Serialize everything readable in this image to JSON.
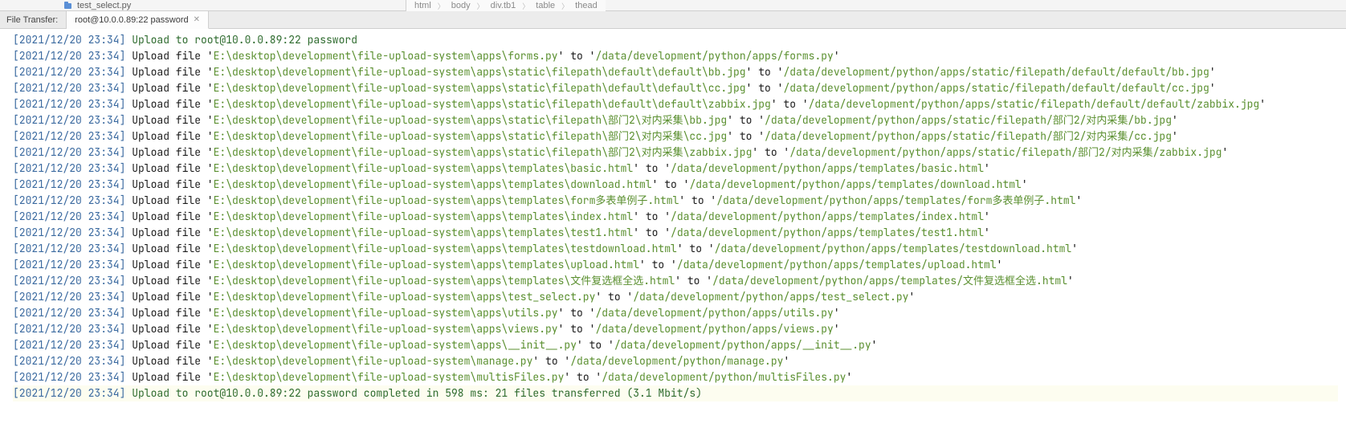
{
  "top_strip": {
    "filename": "test_select.py"
  },
  "breadcrumbs": {
    "items": [
      "html",
      "body",
      "div.tb1",
      "table",
      "thead"
    ]
  },
  "tab_bar": {
    "label": "File Transfer:",
    "active_tab": "root@10.0.0.89:22 password"
  },
  "log": {
    "timestamp": "[2021/12/20 23:34]",
    "header": "Upload to root@10.0.0.89:22 password",
    "lines": [
      {
        "src": "E:\\desktop\\development\\file-upload-system\\apps\\forms.py",
        "dst": "/data/development/python/apps/forms.py"
      },
      {
        "src": "E:\\desktop\\development\\file-upload-system\\apps\\static\\filepath\\default\\default\\bb.jpg",
        "dst": "/data/development/python/apps/static/filepath/default/default/bb.jpg"
      },
      {
        "src": "E:\\desktop\\development\\file-upload-system\\apps\\static\\filepath\\default\\default\\cc.jpg",
        "dst": "/data/development/python/apps/static/filepath/default/default/cc.jpg"
      },
      {
        "src": "E:\\desktop\\development\\file-upload-system\\apps\\static\\filepath\\default\\default\\zabbix.jpg",
        "dst": "/data/development/python/apps/static/filepath/default/default/zabbix.jpg"
      },
      {
        "src": "E:\\desktop\\development\\file-upload-system\\apps\\static\\filepath\\部门2\\对内采集\\bb.jpg",
        "dst": "/data/development/python/apps/static/filepath/部门2/对内采集/bb.jpg"
      },
      {
        "src": "E:\\desktop\\development\\file-upload-system\\apps\\static\\filepath\\部门2\\对内采集\\cc.jpg",
        "dst": "/data/development/python/apps/static/filepath/部门2/对内采集/cc.jpg"
      },
      {
        "src": "E:\\desktop\\development\\file-upload-system\\apps\\static\\filepath\\部门2\\对内采集\\zabbix.jpg",
        "dst": "/data/development/python/apps/static/filepath/部门2/对内采集/zabbix.jpg"
      },
      {
        "src": "E:\\desktop\\development\\file-upload-system\\apps\\templates\\basic.html",
        "dst": "/data/development/python/apps/templates/basic.html"
      },
      {
        "src": "E:\\desktop\\development\\file-upload-system\\apps\\templates\\download.html",
        "dst": "/data/development/python/apps/templates/download.html"
      },
      {
        "src": "E:\\desktop\\development\\file-upload-system\\apps\\templates\\form多表单例子.html",
        "dst": "/data/development/python/apps/templates/form多表单例子.html"
      },
      {
        "src": "E:\\desktop\\development\\file-upload-system\\apps\\templates\\index.html",
        "dst": "/data/development/python/apps/templates/index.html"
      },
      {
        "src": "E:\\desktop\\development\\file-upload-system\\apps\\templates\\test1.html",
        "dst": "/data/development/python/apps/templates/test1.html"
      },
      {
        "src": "E:\\desktop\\development\\file-upload-system\\apps\\templates\\testdownload.html",
        "dst": "/data/development/python/apps/templates/testdownload.html"
      },
      {
        "src": "E:\\desktop\\development\\file-upload-system\\apps\\templates\\upload.html",
        "dst": "/data/development/python/apps/templates/upload.html"
      },
      {
        "src": "E:\\desktop\\development\\file-upload-system\\apps\\templates\\文件复选框全选.html",
        "dst": "/data/development/python/apps/templates/文件复选框全选.html"
      },
      {
        "src": "E:\\desktop\\development\\file-upload-system\\apps\\test_select.py",
        "dst": "/data/development/python/apps/test_select.py"
      },
      {
        "src": "E:\\desktop\\development\\file-upload-system\\apps\\utils.py",
        "dst": "/data/development/python/apps/utils.py"
      },
      {
        "src": "E:\\desktop\\development\\file-upload-system\\apps\\views.py",
        "dst": "/data/development/python/apps/views.py"
      },
      {
        "src": "E:\\desktop\\development\\file-upload-system\\apps\\__init__.py",
        "dst": "/data/development/python/apps/__init__.py"
      },
      {
        "src": "E:\\desktop\\development\\file-upload-system\\manage.py",
        "dst": "/data/development/python/manage.py"
      },
      {
        "src": "E:\\desktop\\development\\file-upload-system\\multisFiles.py",
        "dst": "/data/development/python/multisFiles.py"
      }
    ],
    "summary": "Upload to root@10.0.0.89:22 password completed in 598 ms: 21 files transferred (3.1 Mbit/s)"
  }
}
